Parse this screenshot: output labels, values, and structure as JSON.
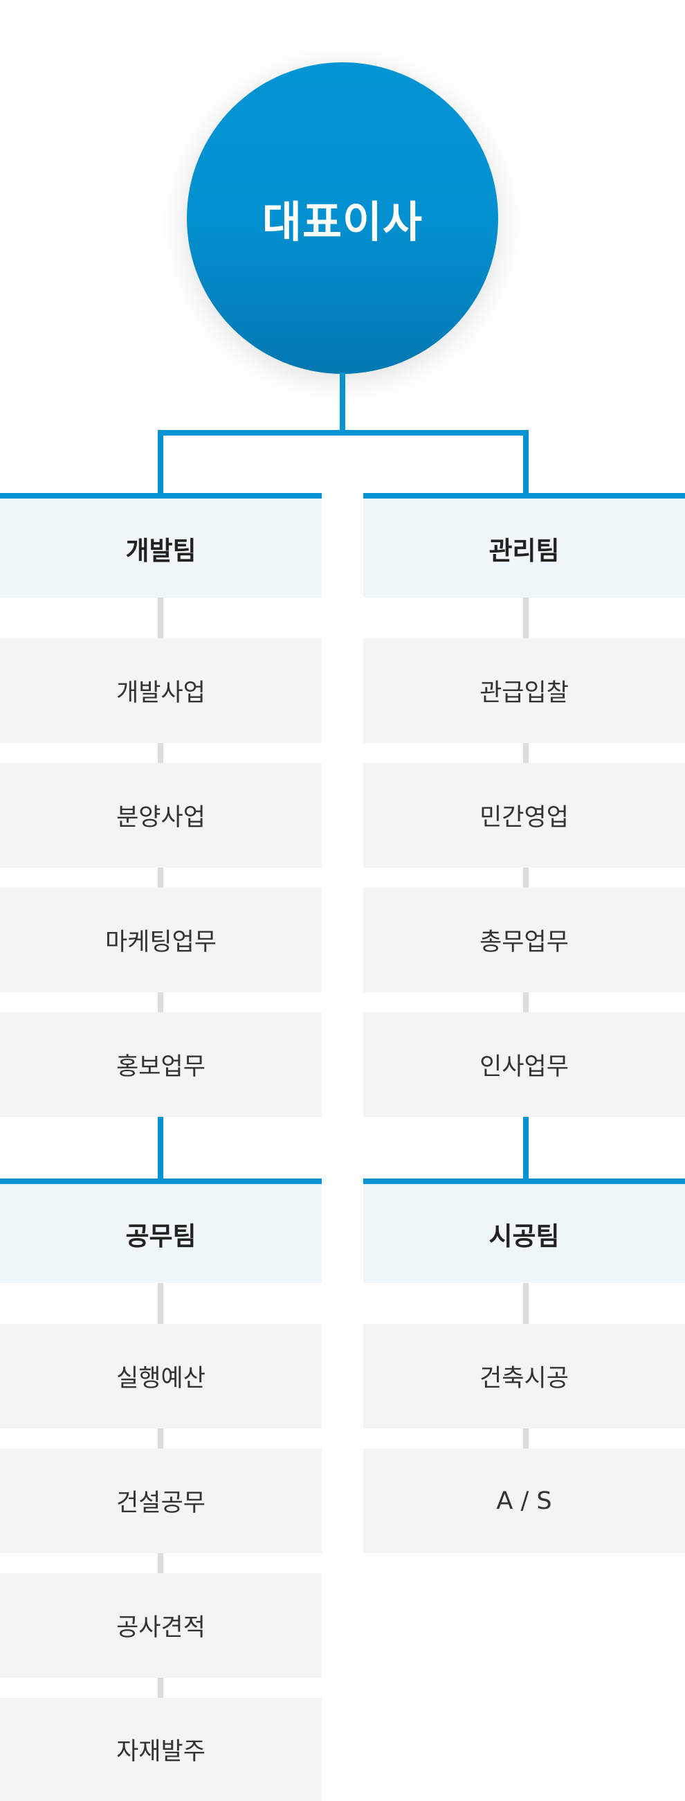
{
  "ceo": {
    "label": "대표이사"
  },
  "teams": {
    "development": {
      "label": "개발팀",
      "tasks": [
        "개발사업",
        "분양사업",
        "마케팅업무",
        "홍보업무"
      ]
    },
    "management": {
      "label": "관리팀",
      "tasks": [
        "관급입찰",
        "민간영업",
        "총무업무",
        "인사업무"
      ]
    },
    "engineering": {
      "label": "공무팀",
      "tasks": [
        "실행예산",
        "건설공무",
        "공사견적",
        "자재발주"
      ]
    },
    "construction": {
      "label": "시공팀",
      "tasks": [
        "건축시공",
        "A / S"
      ]
    }
  },
  "colors": {
    "accent": "#0693d4",
    "team_bg": "#eff7fb",
    "task_bg": "#f4f4f4",
    "connector": "#dcdcdc"
  }
}
